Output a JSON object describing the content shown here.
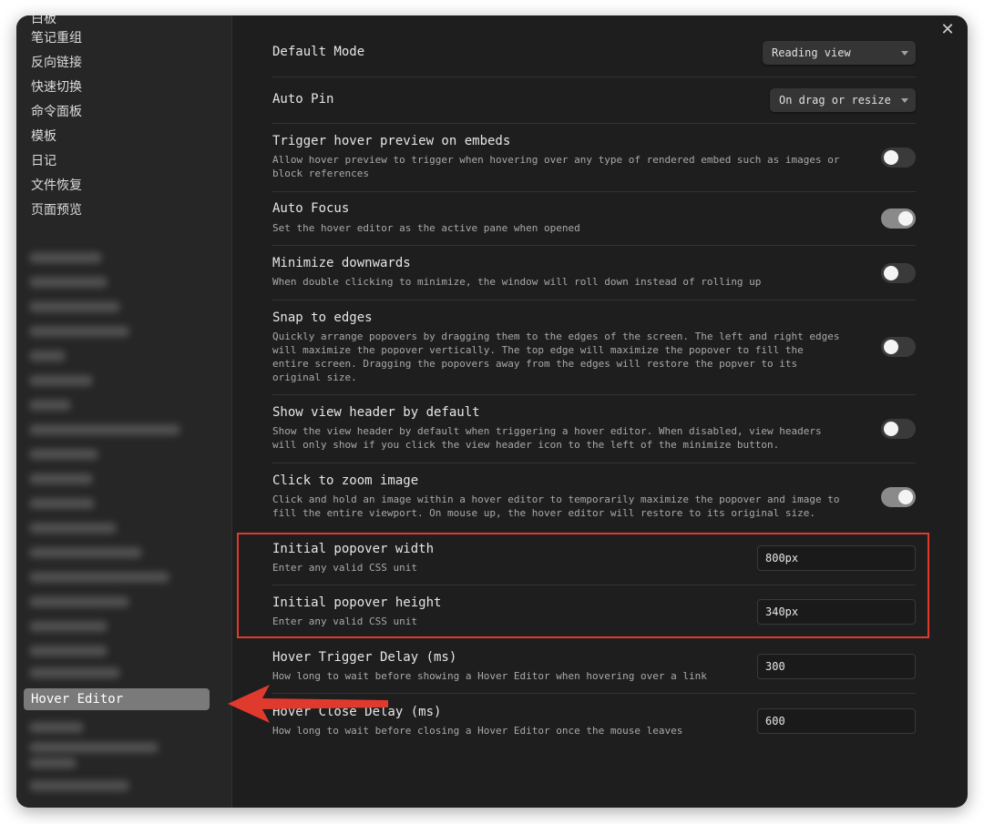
{
  "window": {
    "close_label": "✕"
  },
  "sidebar": {
    "items": [
      {
        "label": "白板"
      },
      {
        "label": "笔记重组"
      },
      {
        "label": "反向链接"
      },
      {
        "label": "快速切换"
      },
      {
        "label": "命令面板"
      },
      {
        "label": "模板"
      },
      {
        "label": "日记"
      },
      {
        "label": "文件恢复"
      },
      {
        "label": "页面预览"
      }
    ],
    "active_item": "Hover Editor"
  },
  "settings": {
    "default_mode": {
      "title": "Default Mode",
      "value": "Reading view"
    },
    "auto_pin": {
      "title": "Auto Pin",
      "value": "On drag or resize"
    },
    "trigger_hover": {
      "title": "Trigger hover preview on embeds",
      "desc": "Allow hover preview to trigger when hovering over any type of rendered embed such as images or\nblock references",
      "enabled": false
    },
    "auto_focus": {
      "title": "Auto Focus",
      "desc": "Set the hover editor as the active pane when opened",
      "enabled": true
    },
    "minimize_downwards": {
      "title": "Minimize downwards",
      "desc": "When double clicking to minimize, the window will roll down instead of rolling up",
      "enabled": false
    },
    "snap_to_edges": {
      "title": "Snap to edges",
      "desc": "Quickly arrange popovers by dragging them to the edges of the screen. The left and right edges\nwill maximize the popover vertically. The top edge will maximize the popover to fill the\nentire screen. Dragging the popovers away from the edges will restore the popver to its\noriginal size.",
      "enabled": false
    },
    "show_view_header": {
      "title": "Show view header by default",
      "desc": "Show the view header by default when triggering a hover editor. When disabled, view headers\nwill only show if you click the view header icon to the left of the minimize button.",
      "enabled": false
    },
    "click_to_zoom": {
      "title": "Click to zoom image",
      "desc": "Click and hold an image within a hover editor to temporarily maximize the popover and image to\nfill the entire viewport. On mouse up, the hover editor will restore to its original size.",
      "enabled": true
    },
    "popover_width": {
      "title": "Initial popover width",
      "desc": "Enter any valid CSS unit",
      "value": "800px"
    },
    "popover_height": {
      "title": "Initial popover height",
      "desc": "Enter any valid CSS unit",
      "value": "340px"
    },
    "hover_trigger_delay": {
      "title": "Hover Trigger Delay (ms)",
      "desc": "How long to wait before showing a Hover Editor when hovering over a link",
      "value": "300"
    },
    "hover_close_delay": {
      "title": "Hover Close Delay (ms)",
      "desc": "How long to wait before closing a Hover Editor once the mouse leaves",
      "value": "600"
    }
  },
  "annotation_colors": {
    "highlight_box": "#e03a2e",
    "arrow": "#e03a2e"
  }
}
